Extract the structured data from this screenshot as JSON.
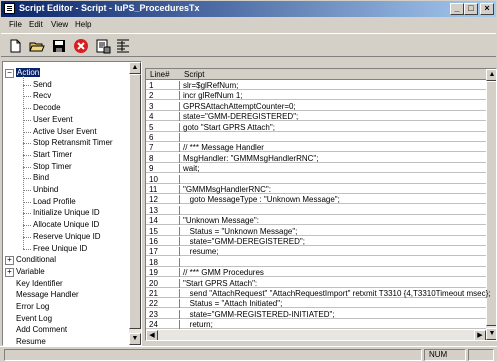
{
  "window": {
    "title": "Script Editor - Script - IuPS_ProceduresTx",
    "min_label": "_",
    "max_label": "□",
    "close_label": "×"
  },
  "menu": [
    "File",
    "Edit",
    "View",
    "Help"
  ],
  "toolbar": {
    "icons": [
      "new-file-icon",
      "open-folder-icon",
      "save-icon",
      "stop-icon",
      "print-preview-icon",
      "align-icon"
    ]
  },
  "tree": {
    "items": [
      {
        "label": "Action",
        "level": 0,
        "expander": "−",
        "selected": true
      },
      {
        "label": "Send",
        "level": 1
      },
      {
        "label": "Recv",
        "level": 1
      },
      {
        "label": "Decode",
        "level": 1
      },
      {
        "label": "User Event",
        "level": 1
      },
      {
        "label": "Active User Event",
        "level": 1
      },
      {
        "label": "Stop Retransmit Timer",
        "level": 1
      },
      {
        "label": "Start Timer",
        "level": 1
      },
      {
        "label": "Stop Timer",
        "level": 1
      },
      {
        "label": "Bind",
        "level": 1
      },
      {
        "label": "Unbind",
        "level": 1
      },
      {
        "label": "Load Profile",
        "level": 1
      },
      {
        "label": "Initialize Unique ID",
        "level": 1
      },
      {
        "label": "Allocate Unique ID",
        "level": 1
      },
      {
        "label": "Reserve Unique ID",
        "level": 1
      },
      {
        "label": "Free Unique ID",
        "level": 1
      },
      {
        "label": "Conditional",
        "level": 0,
        "expander": "+"
      },
      {
        "label": "Variable",
        "level": 0,
        "expander": "+"
      },
      {
        "label": "Key Identifier",
        "level": 0
      },
      {
        "label": "Message Handler",
        "level": 0
      },
      {
        "label": "Error Log",
        "level": 0
      },
      {
        "label": "Event Log",
        "level": 0
      },
      {
        "label": "Add Comment",
        "level": 0
      },
      {
        "label": "Resume",
        "level": 0
      }
    ]
  },
  "editor": {
    "headers": {
      "line": "Line#",
      "script": "Script"
    },
    "rows": [
      {
        "n": "1",
        "code": "slr=$glRefNum;"
      },
      {
        "n": "2",
        "code": "incr glRefNum 1;"
      },
      {
        "n": "3",
        "code": "GPRSAttachAttemptCounter=0;"
      },
      {
        "n": "4",
        "code": "state=\"GMM-DEREGISTERED\";"
      },
      {
        "n": "5",
        "code": "goto \"Start GPRS Attach\";"
      },
      {
        "n": "6",
        "code": ""
      },
      {
        "n": "7",
        "code": "// *** Message Handler"
      },
      {
        "n": "8",
        "code": "MsgHandler: \"GMMMsgHandlerRNC\";"
      },
      {
        "n": "9",
        "code": "wait;"
      },
      {
        "n": "10",
        "code": ""
      },
      {
        "n": "11",
        "code": "\"GMMMsgHandlerRNC\":"
      },
      {
        "n": "12",
        "code": "   goto MessageType : \"Unknown Message\";"
      },
      {
        "n": "13",
        "code": ""
      },
      {
        "n": "14",
        "code": "\"Unknown Message\":"
      },
      {
        "n": "15",
        "code": "   Status = \"Unknown Message\";"
      },
      {
        "n": "16",
        "code": "   state=\"GMM-DEREGISTERED\";"
      },
      {
        "n": "17",
        "code": "   resume;"
      },
      {
        "n": "18",
        "code": ""
      },
      {
        "n": "19",
        "code": "// *** GMM Procedures"
      },
      {
        "n": "20",
        "code": "\"Start GPRS Attach\":"
      },
      {
        "n": "21",
        "code": "   send \"AttachRequest\" \"AttachRequestImport\" retxmit T3310 {4,T3310Timeout msec};"
      },
      {
        "n": "22",
        "code": "   Status = \"Attach Initiated\";"
      },
      {
        "n": "23",
        "code": "   state=\"GMM-REGISTERED-INITIATED\";"
      },
      {
        "n": "24",
        "code": "   return;"
      }
    ]
  },
  "status": {
    "num": "NUM"
  }
}
